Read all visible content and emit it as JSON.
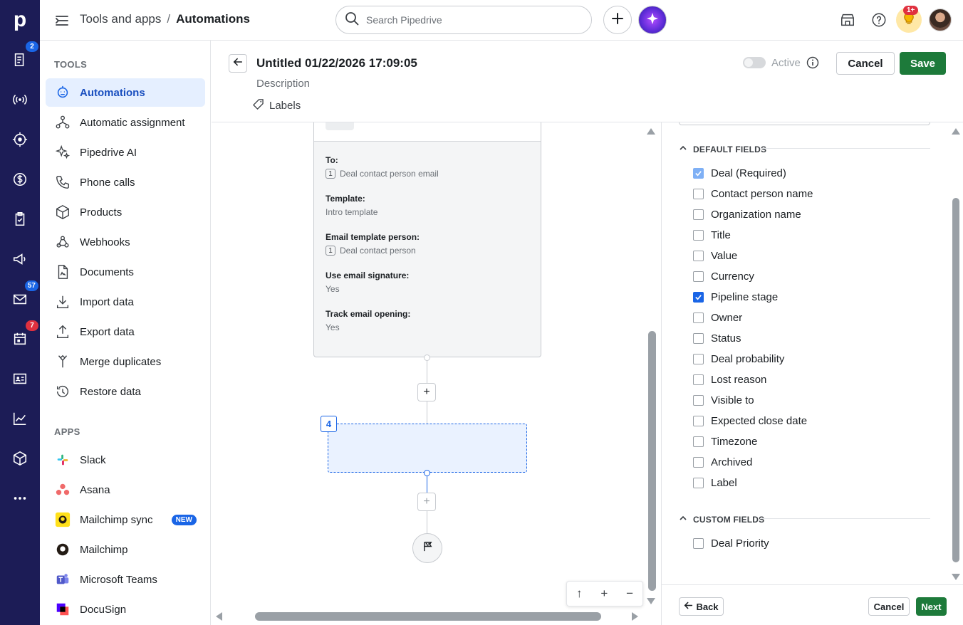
{
  "rail": {
    "logo": "p",
    "items": [
      {
        "icon": "deals-icon",
        "badge": "2",
        "badge_color": "#1a65e6"
      },
      {
        "icon": "broadcast-icon",
        "badge": ""
      },
      {
        "icon": "target-icon",
        "badge": ""
      },
      {
        "icon": "dollar-icon",
        "badge": ""
      },
      {
        "icon": "clipboard-check-icon",
        "badge": ""
      },
      {
        "icon": "megaphone-icon",
        "badge": ""
      },
      {
        "icon": "mail-icon",
        "badge": "57",
        "badge_color": "#1a65e6"
      },
      {
        "icon": "calendar-icon",
        "badge": "7",
        "badge_color": "#e0303f"
      },
      {
        "icon": "contact-card-icon",
        "badge": ""
      },
      {
        "icon": "chart-line-icon",
        "badge": ""
      },
      {
        "icon": "box-icon",
        "badge": ""
      },
      {
        "icon": "more-dots-icon",
        "badge": ""
      }
    ]
  },
  "topbar": {
    "breadcrumb_parent": "Tools and apps",
    "breadcrumb_separator": "/",
    "breadcrumb_current": "Automations",
    "search_placeholder": "Search Pipedrive",
    "notification_badge": "1+"
  },
  "sidebar": {
    "tools_heading": "TOOLS",
    "tools": [
      {
        "label": "Automations",
        "icon": "robot-icon",
        "active": true
      },
      {
        "label": "Automatic assignment",
        "icon": "assignment-icon"
      },
      {
        "label": "Pipedrive AI",
        "icon": "sparkle-icon"
      },
      {
        "label": "Phone calls",
        "icon": "phone-icon"
      },
      {
        "label": "Products",
        "icon": "product-box-icon"
      },
      {
        "label": "Webhooks",
        "icon": "webhook-icon"
      },
      {
        "label": "Documents",
        "icon": "document-icon"
      },
      {
        "label": "Import data",
        "icon": "import-icon"
      },
      {
        "label": "Export data",
        "icon": "export-icon"
      },
      {
        "label": "Merge duplicates",
        "icon": "merge-icon"
      },
      {
        "label": "Restore data",
        "icon": "restore-icon"
      }
    ],
    "apps_heading": "APPS",
    "apps": [
      {
        "label": "Slack",
        "icon": "slack-icon"
      },
      {
        "label": "Asana",
        "icon": "asana-icon"
      },
      {
        "label": "Mailchimp sync",
        "icon": "mailchimp-icon",
        "badge": "NEW"
      },
      {
        "label": "Mailchimp",
        "icon": "mailchimp-mono-icon"
      },
      {
        "label": "Microsoft Teams",
        "icon": "teams-icon"
      },
      {
        "label": "DocuSign",
        "icon": "docusign-icon"
      }
    ]
  },
  "automation": {
    "title": "Untitled 01/22/2026 17:09:05",
    "description_placeholder": "Description",
    "labels": "Labels",
    "active_label": "Active",
    "active": false,
    "cancel_label": "Cancel",
    "save_label": "Save"
  },
  "canvas": {
    "step_fields": [
      {
        "label": "To:",
        "value": "Deal contact person email",
        "chip": "1"
      },
      {
        "label": "Template:",
        "value": "Intro template",
        "chip": ""
      },
      {
        "label": "Email template person:",
        "value": "Deal contact person",
        "chip": "1"
      },
      {
        "label": "Use email signature:",
        "value": "Yes",
        "chip": ""
      },
      {
        "label": "Track email opening:",
        "value": "Yes",
        "chip": ""
      }
    ],
    "plus_symbol": "+",
    "new_step_number": "4",
    "zoom_controls": [
      "↑",
      "+",
      "−"
    ]
  },
  "panel": {
    "default_fields_heading": "DEFAULT FIELDS",
    "default_fields": [
      {
        "label": "Deal (Required)",
        "checked": true,
        "disabled": true
      },
      {
        "label": "Contact person name",
        "checked": false
      },
      {
        "label": "Organization name",
        "checked": false
      },
      {
        "label": "Title",
        "checked": false
      },
      {
        "label": "Value",
        "checked": false
      },
      {
        "label": "Currency",
        "checked": false
      },
      {
        "label": "Pipeline stage",
        "checked": true
      },
      {
        "label": "Owner",
        "checked": false
      },
      {
        "label": "Status",
        "checked": false
      },
      {
        "label": "Deal probability",
        "checked": false
      },
      {
        "label": "Lost reason",
        "checked": false
      },
      {
        "label": "Visible to",
        "checked": false
      },
      {
        "label": "Expected close date",
        "checked": false
      },
      {
        "label": "Timezone",
        "checked": false
      },
      {
        "label": "Archived",
        "checked": false
      },
      {
        "label": "Label",
        "checked": false
      }
    ],
    "custom_fields_heading": "CUSTOM FIELDS",
    "custom_fields": [
      {
        "label": "Deal Priority",
        "checked": false
      }
    ],
    "back_label": "Back",
    "cancel_label": "Cancel",
    "next_label": "Next"
  },
  "colors": {
    "rail_bg": "#1c1c56",
    "accent_blue": "#1a65e6",
    "save_green": "#1d7a3a",
    "active_item_bg": "#e5efff"
  }
}
